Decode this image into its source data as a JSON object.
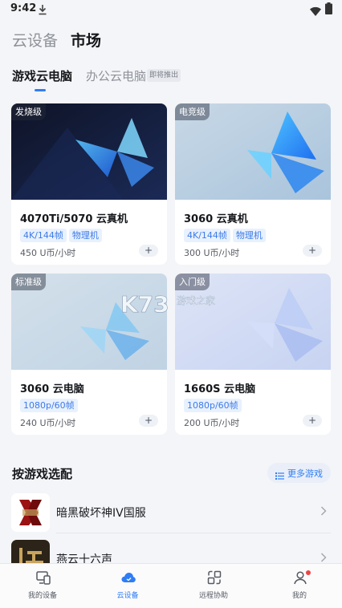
{
  "status_bar": {
    "time": "9:42"
  },
  "top_tabs": [
    {
      "label": "云设备",
      "active": false
    },
    {
      "label": "市场",
      "active": true
    }
  ],
  "sub_tabs": [
    {
      "label": "游戏云电脑",
      "active": true
    },
    {
      "label": "办公云电脑",
      "active": false,
      "badge": "即将推出"
    }
  ],
  "cards": [
    {
      "tier": "发烧级",
      "name": "4070Ti/5070 云真机",
      "tags": [
        "4K/144帧",
        "物理机"
      ],
      "price": "450 U币/小时",
      "add_icon": "plus-icon",
      "theme": "dark-blue"
    },
    {
      "tier": "电竞级",
      "name": "3060 云真机",
      "tags": [
        "4K/144帧",
        "物理机"
      ],
      "price": "300 U币/小时",
      "add_icon": "plus-icon",
      "theme": "light-blue"
    },
    {
      "tier": "标准级",
      "name": "3060 云电脑",
      "tags": [
        "1080p/60帧"
      ],
      "price": "240 U币/小时",
      "add_icon": "plus-icon",
      "theme": "pale-blue"
    },
    {
      "tier": "入门级",
      "name": "1660S 云电脑",
      "tags": [
        "1080p/60帧"
      ],
      "price": "200 U币/小时",
      "add_icon": "plus-icon",
      "theme": "lavender"
    }
  ],
  "game_section": {
    "title": "按游戏选配",
    "more_label": "更多游戏",
    "games": [
      {
        "title": "暗黑破坏神IV国服",
        "icon": "diablo-icon"
      },
      {
        "title": "燕云十六声",
        "icon": "yanyun-icon"
      }
    ]
  },
  "watermark": {
    "logo": "K73",
    "text": "游戏之家"
  },
  "bottom_nav": [
    {
      "label": "我的设备",
      "icon": "devices-icon",
      "active": false
    },
    {
      "label": "云设备",
      "icon": "cloud-icon",
      "active": true
    },
    {
      "label": "远程协助",
      "icon": "remote-assist-icon",
      "active": false
    },
    {
      "label": "我的",
      "icon": "profile-icon",
      "active": false,
      "notification_dot": true
    }
  ],
  "colors": {
    "accent": "#2f7df6",
    "tag_bg": "#e8f1fe",
    "notification": "#ef4444"
  }
}
